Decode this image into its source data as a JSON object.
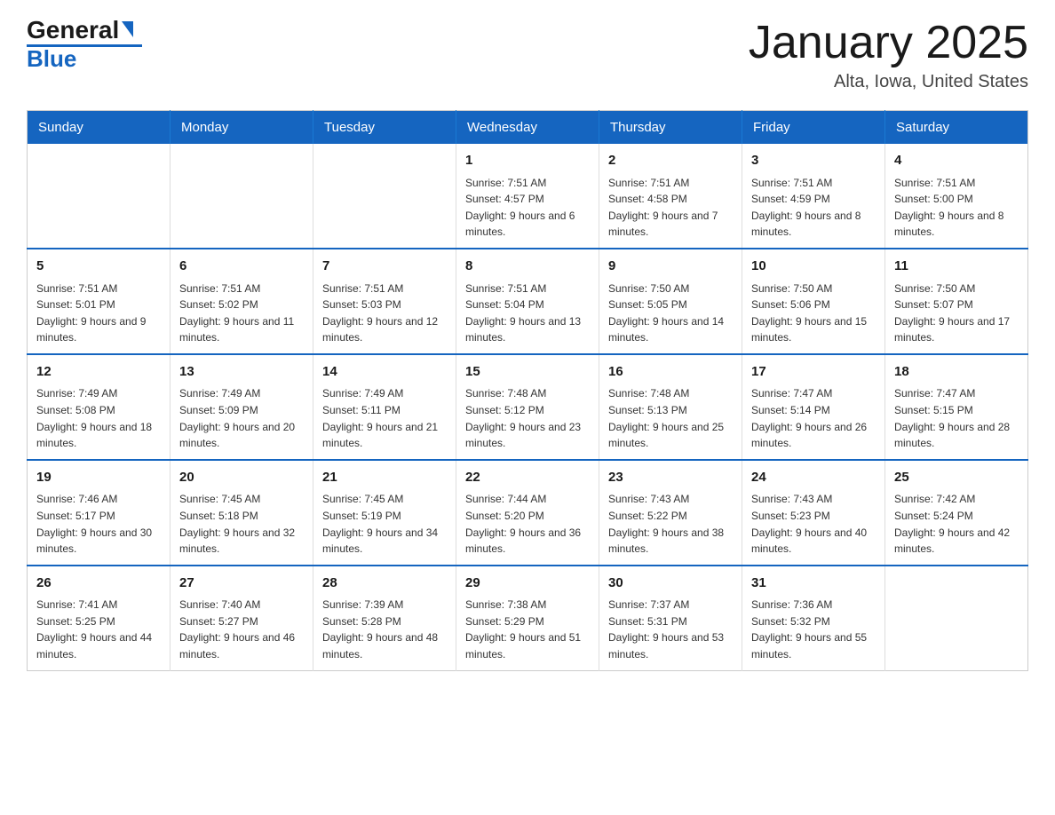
{
  "header": {
    "logo": {
      "part1": "General",
      "part2": "Blue"
    },
    "title": "January 2025",
    "location": "Alta, Iowa, United States"
  },
  "calendar": {
    "days_of_week": [
      "Sunday",
      "Monday",
      "Tuesday",
      "Wednesday",
      "Thursday",
      "Friday",
      "Saturday"
    ],
    "weeks": [
      [
        {
          "day": "",
          "info": ""
        },
        {
          "day": "",
          "info": ""
        },
        {
          "day": "",
          "info": ""
        },
        {
          "day": "1",
          "info": "Sunrise: 7:51 AM\nSunset: 4:57 PM\nDaylight: 9 hours and 6 minutes."
        },
        {
          "day": "2",
          "info": "Sunrise: 7:51 AM\nSunset: 4:58 PM\nDaylight: 9 hours and 7 minutes."
        },
        {
          "day": "3",
          "info": "Sunrise: 7:51 AM\nSunset: 4:59 PM\nDaylight: 9 hours and 8 minutes."
        },
        {
          "day": "4",
          "info": "Sunrise: 7:51 AM\nSunset: 5:00 PM\nDaylight: 9 hours and 8 minutes."
        }
      ],
      [
        {
          "day": "5",
          "info": "Sunrise: 7:51 AM\nSunset: 5:01 PM\nDaylight: 9 hours and 9 minutes."
        },
        {
          "day": "6",
          "info": "Sunrise: 7:51 AM\nSunset: 5:02 PM\nDaylight: 9 hours and 11 minutes."
        },
        {
          "day": "7",
          "info": "Sunrise: 7:51 AM\nSunset: 5:03 PM\nDaylight: 9 hours and 12 minutes."
        },
        {
          "day": "8",
          "info": "Sunrise: 7:51 AM\nSunset: 5:04 PM\nDaylight: 9 hours and 13 minutes."
        },
        {
          "day": "9",
          "info": "Sunrise: 7:50 AM\nSunset: 5:05 PM\nDaylight: 9 hours and 14 minutes."
        },
        {
          "day": "10",
          "info": "Sunrise: 7:50 AM\nSunset: 5:06 PM\nDaylight: 9 hours and 15 minutes."
        },
        {
          "day": "11",
          "info": "Sunrise: 7:50 AM\nSunset: 5:07 PM\nDaylight: 9 hours and 17 minutes."
        }
      ],
      [
        {
          "day": "12",
          "info": "Sunrise: 7:49 AM\nSunset: 5:08 PM\nDaylight: 9 hours and 18 minutes."
        },
        {
          "day": "13",
          "info": "Sunrise: 7:49 AM\nSunset: 5:09 PM\nDaylight: 9 hours and 20 minutes."
        },
        {
          "day": "14",
          "info": "Sunrise: 7:49 AM\nSunset: 5:11 PM\nDaylight: 9 hours and 21 minutes."
        },
        {
          "day": "15",
          "info": "Sunrise: 7:48 AM\nSunset: 5:12 PM\nDaylight: 9 hours and 23 minutes."
        },
        {
          "day": "16",
          "info": "Sunrise: 7:48 AM\nSunset: 5:13 PM\nDaylight: 9 hours and 25 minutes."
        },
        {
          "day": "17",
          "info": "Sunrise: 7:47 AM\nSunset: 5:14 PM\nDaylight: 9 hours and 26 minutes."
        },
        {
          "day": "18",
          "info": "Sunrise: 7:47 AM\nSunset: 5:15 PM\nDaylight: 9 hours and 28 minutes."
        }
      ],
      [
        {
          "day": "19",
          "info": "Sunrise: 7:46 AM\nSunset: 5:17 PM\nDaylight: 9 hours and 30 minutes."
        },
        {
          "day": "20",
          "info": "Sunrise: 7:45 AM\nSunset: 5:18 PM\nDaylight: 9 hours and 32 minutes."
        },
        {
          "day": "21",
          "info": "Sunrise: 7:45 AM\nSunset: 5:19 PM\nDaylight: 9 hours and 34 minutes."
        },
        {
          "day": "22",
          "info": "Sunrise: 7:44 AM\nSunset: 5:20 PM\nDaylight: 9 hours and 36 minutes."
        },
        {
          "day": "23",
          "info": "Sunrise: 7:43 AM\nSunset: 5:22 PM\nDaylight: 9 hours and 38 minutes."
        },
        {
          "day": "24",
          "info": "Sunrise: 7:43 AM\nSunset: 5:23 PM\nDaylight: 9 hours and 40 minutes."
        },
        {
          "day": "25",
          "info": "Sunrise: 7:42 AM\nSunset: 5:24 PM\nDaylight: 9 hours and 42 minutes."
        }
      ],
      [
        {
          "day": "26",
          "info": "Sunrise: 7:41 AM\nSunset: 5:25 PM\nDaylight: 9 hours and 44 minutes."
        },
        {
          "day": "27",
          "info": "Sunrise: 7:40 AM\nSunset: 5:27 PM\nDaylight: 9 hours and 46 minutes."
        },
        {
          "day": "28",
          "info": "Sunrise: 7:39 AM\nSunset: 5:28 PM\nDaylight: 9 hours and 48 minutes."
        },
        {
          "day": "29",
          "info": "Sunrise: 7:38 AM\nSunset: 5:29 PM\nDaylight: 9 hours and 51 minutes."
        },
        {
          "day": "30",
          "info": "Sunrise: 7:37 AM\nSunset: 5:31 PM\nDaylight: 9 hours and 53 minutes."
        },
        {
          "day": "31",
          "info": "Sunrise: 7:36 AM\nSunset: 5:32 PM\nDaylight: 9 hours and 55 minutes."
        },
        {
          "day": "",
          "info": ""
        }
      ]
    ]
  }
}
